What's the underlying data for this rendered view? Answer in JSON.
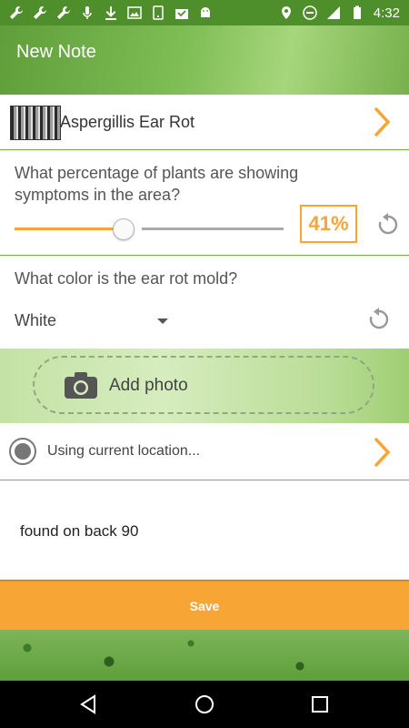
{
  "status_bar": {
    "time": "4:32",
    "left_icons": [
      "wrench-icon",
      "wrench-icon",
      "wrench-icon",
      "mic-icon",
      "download-icon",
      "image-icon",
      "phone-icon",
      "checkmark-tray-icon",
      "android-icon"
    ],
    "right_icons": [
      "location-icon",
      "dnd-icon",
      "signal-icon",
      "battery-icon"
    ]
  },
  "app_bar": {
    "title": "New Note"
  },
  "disease": {
    "label": "Aspergillis Ear Rot"
  },
  "question_percentage": {
    "text": "What percentage of plants are showing symptoms in the area?",
    "value": 41,
    "value_display": "41%"
  },
  "question_color": {
    "text": "What color is the ear rot mold?",
    "selected": "White"
  },
  "photo": {
    "label": "Add photo"
  },
  "location": {
    "label": "Using current location..."
  },
  "notes": {
    "text": "found on back 90"
  },
  "save": {
    "label": "Save"
  },
  "colors": {
    "accent": "#f7a535",
    "primary": "#6fb640"
  }
}
